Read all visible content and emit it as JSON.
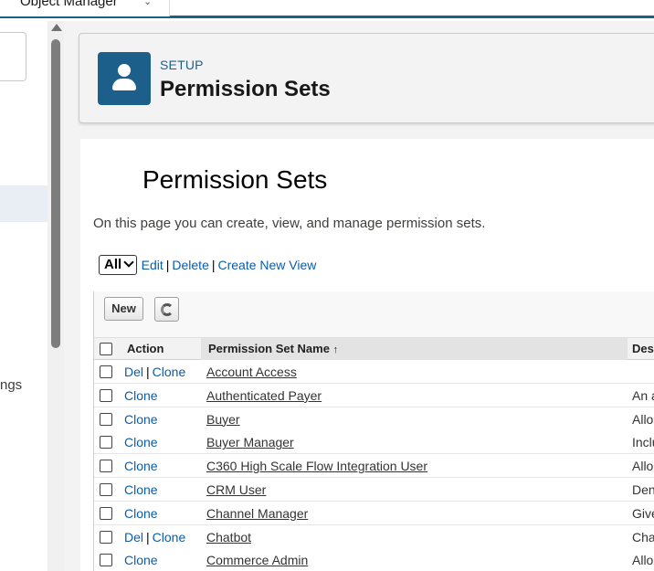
{
  "tab": {
    "label": "Object Manager"
  },
  "leftnav": {
    "label_fragment": "ngs"
  },
  "header": {
    "eyebrow": "SETUP",
    "title": "Permission Sets"
  },
  "content": {
    "title": "Permission Sets",
    "description": "On this page you can create, view, and manage permission sets."
  },
  "viewbar": {
    "selected_view": "All",
    "links": [
      "Edit",
      "Delete",
      "Create New View"
    ]
  },
  "toolbar": {
    "new_label": "New"
  },
  "table": {
    "columns": [
      "Action",
      "Permission Set Name",
      "Des"
    ],
    "sort_indicator": "↑",
    "rows": [
      {
        "actions": [
          "Del",
          "Clone"
        ],
        "name": "Account Access",
        "desc": ""
      },
      {
        "actions": [
          "Clone"
        ],
        "name": "Authenticated Payer",
        "desc": "An a"
      },
      {
        "actions": [
          "Clone"
        ],
        "name": "Buyer",
        "desc": "Allo"
      },
      {
        "actions": [
          "Clone"
        ],
        "name": "Buyer Manager",
        "desc": "Inclu"
      },
      {
        "actions": [
          "Clone"
        ],
        "name": "C360 High Scale Flow Integration User",
        "desc": "Allo"
      },
      {
        "actions": [
          "Clone"
        ],
        "name": "CRM User",
        "desc": "Den"
      },
      {
        "actions": [
          "Clone"
        ],
        "name": "Channel Manager",
        "desc": "Give"
      },
      {
        "actions": [
          "Del",
          "Clone"
        ],
        "name": "Chatbot",
        "desc": "Cha"
      },
      {
        "actions": [
          "Clone"
        ],
        "name": "Commerce Admin",
        "desc": "Allo"
      }
    ]
  },
  "colors": {
    "brand": "#1b5f8a",
    "link": "#0b5cab"
  }
}
